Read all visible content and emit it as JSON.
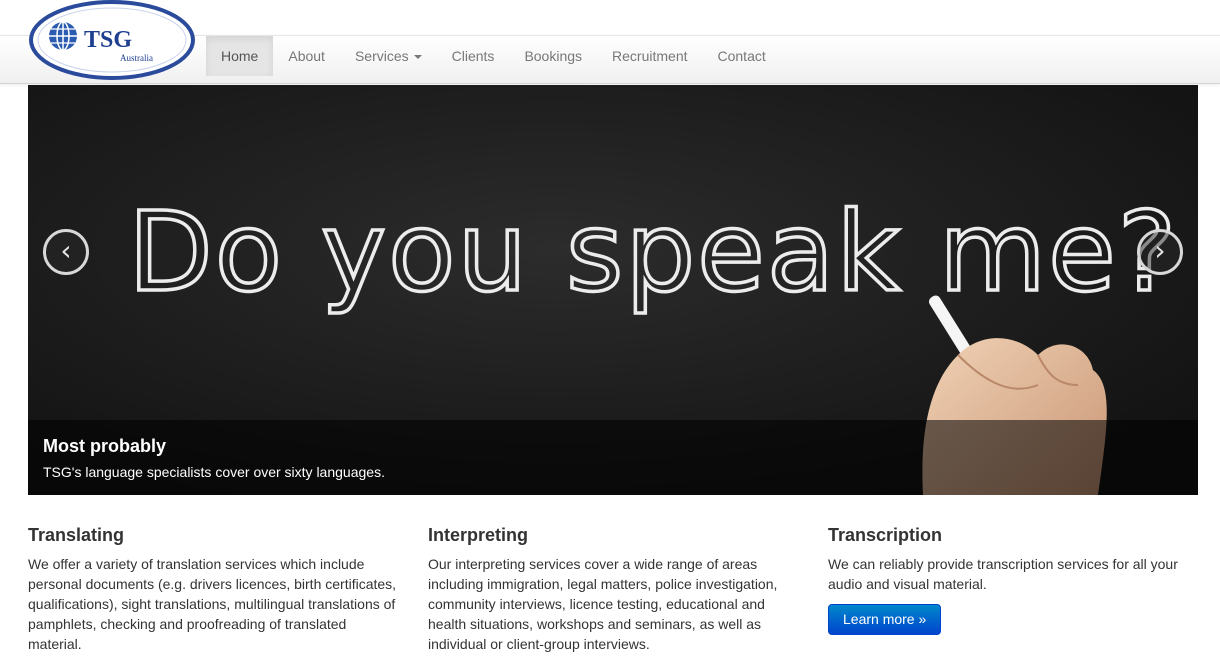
{
  "brand": {
    "name": "TSG",
    "subtitle": "Australia"
  },
  "nav": {
    "items": [
      {
        "label": "Home",
        "active": true
      },
      {
        "label": "About"
      },
      {
        "label": "Services",
        "dropdown": true
      },
      {
        "label": "Clients"
      },
      {
        "label": "Bookings"
      },
      {
        "label": "Recruitment"
      },
      {
        "label": "Contact"
      }
    ]
  },
  "carousel": {
    "chalk_text": "Do you speak me?",
    "prev_icon": "‹",
    "next_icon": "›",
    "caption": {
      "title": "Most probably",
      "text": "TSG's language specialists cover over sixty languages."
    }
  },
  "columns": [
    {
      "title": "Translating",
      "text": "We offer a variety of translation services which include personal documents (e.g. drivers licences, birth certificates, qualifications), sight translations, multilingual translations of pamphlets, checking and proofreading of translated material."
    },
    {
      "title": "Interpreting",
      "text": "Our interpreting services cover a wide range of areas including immigration, legal matters, police investigation, community interviews, licence testing, educational and health situations, workshops and seminars, as well as individual or client-group interviews."
    },
    {
      "title": "Transcription",
      "text": "We can reliably provide transcription services for all your audio and visual material.",
      "button": "Learn more »"
    }
  ],
  "colors": {
    "logo_blue": "#1e3f8f",
    "primary_button": "#0066cc",
    "carousel_bg": "#1c1c1c"
  }
}
